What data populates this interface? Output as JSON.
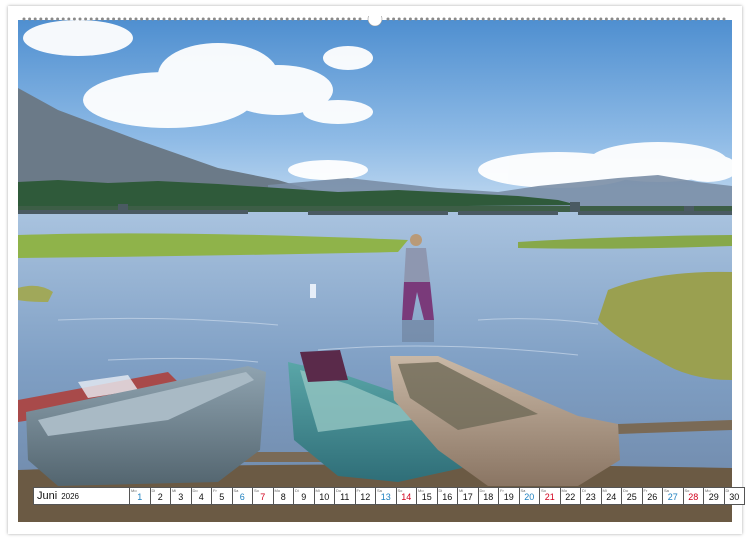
{
  "calendar": {
    "month": "Juni",
    "year": "2026",
    "days": [
      {
        "n": "1",
        "d": "Mo",
        "t": "hol"
      },
      {
        "n": "2",
        "d": "Di",
        "t": ""
      },
      {
        "n": "3",
        "d": "Mi",
        "t": ""
      },
      {
        "n": "4",
        "d": "Do",
        "t": ""
      },
      {
        "n": "5",
        "d": "Fr",
        "t": ""
      },
      {
        "n": "6",
        "d": "Sa",
        "t": "hol"
      },
      {
        "n": "7",
        "d": "So",
        "t": "sun"
      },
      {
        "n": "8",
        "d": "Mo",
        "t": ""
      },
      {
        "n": "9",
        "d": "Di",
        "t": ""
      },
      {
        "n": "10",
        "d": "Mi",
        "t": ""
      },
      {
        "n": "11",
        "d": "Do",
        "t": ""
      },
      {
        "n": "12",
        "d": "Fr",
        "t": ""
      },
      {
        "n": "13",
        "d": "Sa",
        "t": "hol"
      },
      {
        "n": "14",
        "d": "So",
        "t": "sun"
      },
      {
        "n": "15",
        "d": "Mo",
        "t": ""
      },
      {
        "n": "16",
        "d": "Di",
        "t": ""
      },
      {
        "n": "17",
        "d": "Mi",
        "t": ""
      },
      {
        "n": "18",
        "d": "Do",
        "t": ""
      },
      {
        "n": "19",
        "d": "Fr",
        "t": ""
      },
      {
        "n": "20",
        "d": "Sa",
        "t": "hol"
      },
      {
        "n": "21",
        "d": "So",
        "t": "sun"
      },
      {
        "n": "22",
        "d": "Mo",
        "t": ""
      },
      {
        "n": "23",
        "d": "Di",
        "t": ""
      },
      {
        "n": "24",
        "d": "Mi",
        "t": ""
      },
      {
        "n": "25",
        "d": "Do",
        "t": ""
      },
      {
        "n": "26",
        "d": "Fr",
        "t": ""
      },
      {
        "n": "27",
        "d": "Sa",
        "t": "hol"
      },
      {
        "n": "28",
        "d": "So",
        "t": "sun"
      },
      {
        "n": "29",
        "d": "Mo",
        "t": ""
      },
      {
        "n": "30",
        "d": "Di",
        "t": ""
      }
    ]
  },
  "colors": {
    "sunday": "#d1001c",
    "saturday": "#1c7fbf",
    "sky": "#5f9bd6",
    "water": "#8fb0d4"
  }
}
